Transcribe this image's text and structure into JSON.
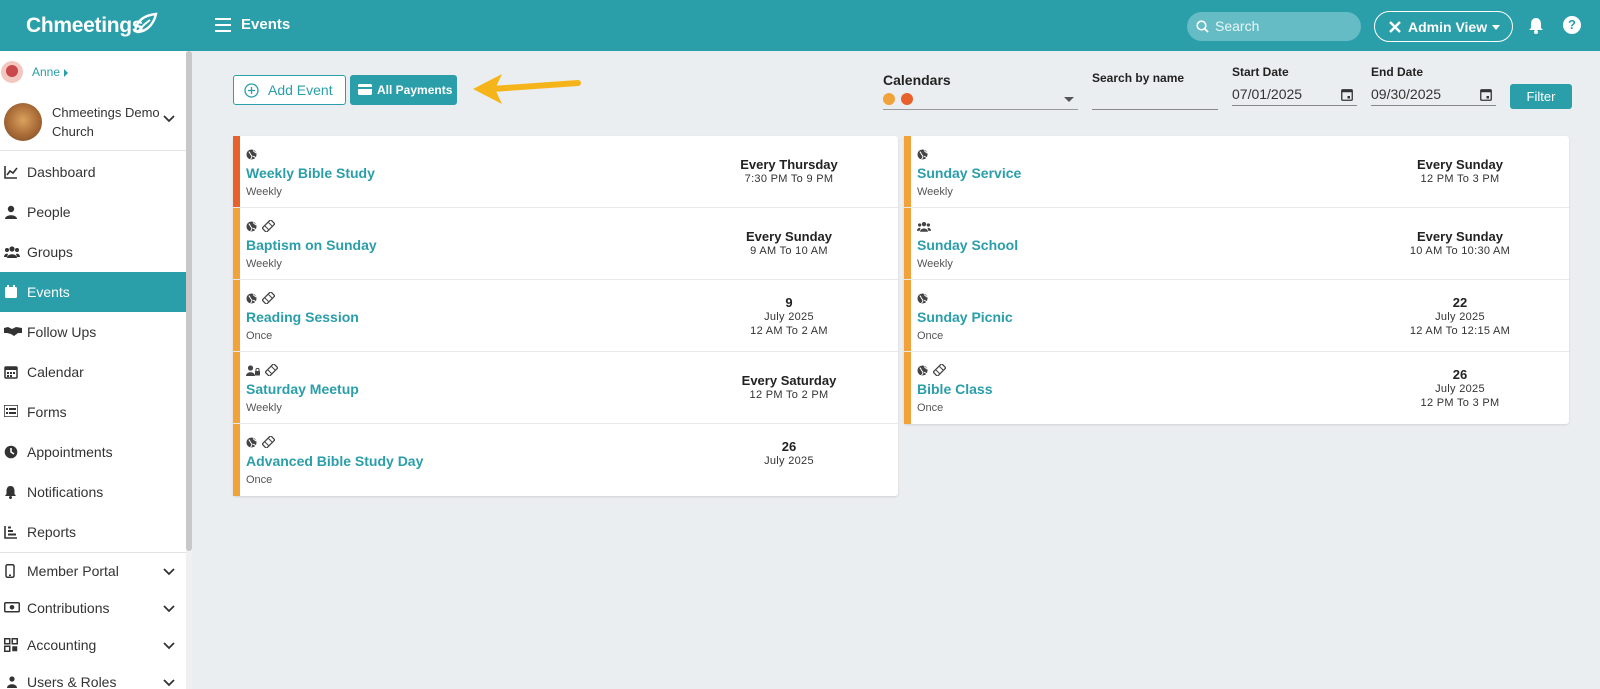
{
  "topbar": {
    "logo": "Chmeetings",
    "title": "Events",
    "search_placeholder": "Search",
    "admin_view": "Admin View",
    "help": "?"
  },
  "sidebar": {
    "user": "Anne",
    "church": "Chmeetings Demo Church",
    "items": [
      {
        "label": "Dashboard",
        "icon": "chart-line-icon"
      },
      {
        "label": "People",
        "icon": "person-icon"
      },
      {
        "label": "Groups",
        "icon": "users-icon"
      },
      {
        "label": "Events",
        "icon": "calendar-icon"
      },
      {
        "label": "Follow Ups",
        "icon": "handshake-icon"
      },
      {
        "label": "Calendar",
        "icon": "calendar-grid-icon"
      },
      {
        "label": "Forms",
        "icon": "list-icon"
      },
      {
        "label": "Appointments",
        "icon": "clock-icon"
      },
      {
        "label": "Notifications",
        "icon": "bell-icon"
      },
      {
        "label": "Reports",
        "icon": "report-icon"
      }
    ],
    "groups": [
      {
        "label": "Member Portal",
        "icon": "phone-icon"
      },
      {
        "label": "Contributions",
        "icon": "money-icon"
      },
      {
        "label": "Accounting",
        "icon": "grid-icon"
      },
      {
        "label": "Users & Roles",
        "icon": "users-icon"
      }
    ]
  },
  "toolbar": {
    "add_event": "Add Event",
    "all_payments": "All Payments"
  },
  "filters": {
    "calendars_label": "Calendars",
    "calendar_colors": [
      "#f2a23a",
      "#e8602a"
    ],
    "search_by_name_label": "Search by name",
    "search_by_name_value": "",
    "start_date_label": "Start Date",
    "start_date": "07/01/2025",
    "end_date_label": "End Date",
    "end_date": "09/30/2025",
    "filter_button": "Filter"
  },
  "events_left": [
    {
      "name": "Weekly Bible Study",
      "freq": "Weekly",
      "when": "Every Thursday",
      "month": "",
      "time": "7:30 PM To 9 PM",
      "color": "#e8602a",
      "icons": [
        "globe-icon"
      ]
    },
    {
      "name": "Baptism on Sunday",
      "freq": "Weekly",
      "when": "Every Sunday",
      "month": "",
      "time": "9 AM To 10 AM",
      "color": "#f2a23a",
      "icons": [
        "globe-icon",
        "ticket-icon"
      ]
    },
    {
      "name": "Reading Session",
      "freq": "Once",
      "when": "9",
      "month": "July 2025",
      "time": "12 AM To 2 AM",
      "color": "#f2a23a",
      "icons": [
        "globe-icon",
        "ticket-icon"
      ]
    },
    {
      "name": "Saturday Meetup",
      "freq": "Weekly",
      "when": "Every Saturday",
      "month": "",
      "time": "12 PM To 2 PM",
      "color": "#f2a23a",
      "icons": [
        "user-lock-icon",
        "ticket-icon"
      ]
    },
    {
      "name": "Advanced Bible Study Day",
      "freq": "Once",
      "when": "26",
      "month": "July 2025",
      "time": "",
      "color": "#f2a23a",
      "icons": [
        "globe-icon",
        "ticket-icon"
      ]
    }
  ],
  "events_right": [
    {
      "name": "Sunday Service",
      "freq": "Weekly",
      "when": "Every Sunday",
      "month": "",
      "time": "12 PM To 3 PM",
      "color": "#f2a23a",
      "icons": [
        "globe-icon"
      ]
    },
    {
      "name": "Sunday School",
      "freq": "Weekly",
      "when": "Every Sunday",
      "month": "",
      "time": "10 AM To 10:30 AM",
      "color": "#f2a23a",
      "icons": [
        "users-icon"
      ]
    },
    {
      "name": "Sunday Picnic",
      "freq": "Once",
      "when": "22",
      "month": "July 2025",
      "time": "12 AM To 12:15 AM",
      "color": "#f2a23a",
      "icons": [
        "globe-icon"
      ]
    },
    {
      "name": "Bible Class",
      "freq": "Once",
      "when": "26",
      "month": "July 2025",
      "time": "12 PM To 3 PM",
      "color": "#f2a23a",
      "icons": [
        "globe-icon",
        "ticket-icon"
      ]
    }
  ]
}
